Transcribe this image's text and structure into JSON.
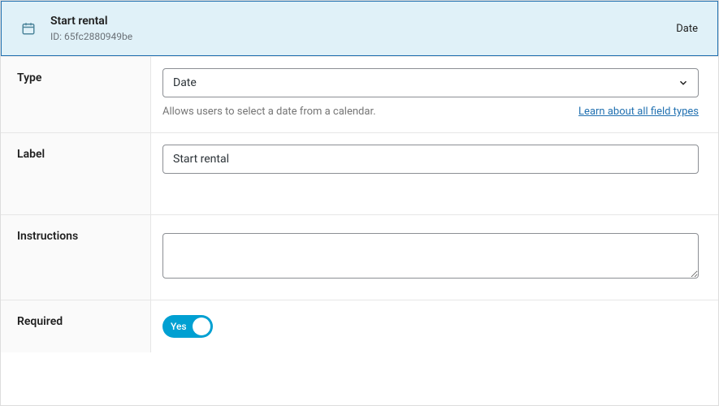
{
  "header": {
    "title": "Start rental",
    "id_prefix": "ID: ",
    "id": "65fc2880949be",
    "type_badge": "Date"
  },
  "rows": {
    "type": {
      "label": "Type",
      "selected": "Date",
      "help": "Allows users to select a date from a calendar.",
      "learn_link": "Learn about all field types"
    },
    "label": {
      "label": "Label",
      "value": "Start rental"
    },
    "instructions": {
      "label": "Instructions",
      "value": ""
    },
    "required": {
      "label": "Required",
      "on_text": "Yes",
      "value": true
    }
  }
}
